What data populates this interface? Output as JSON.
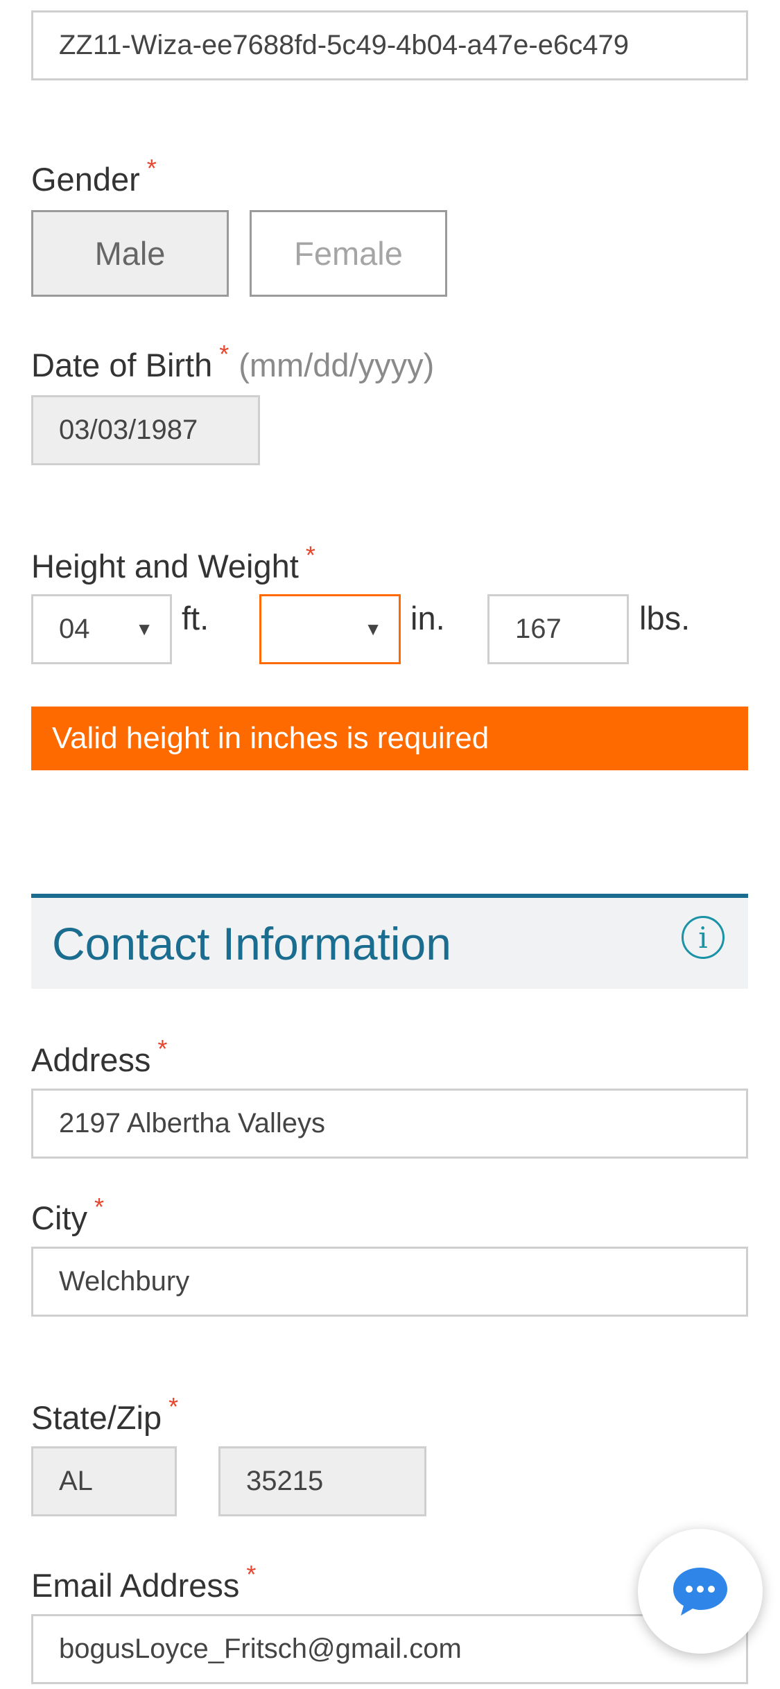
{
  "id_field": {
    "value": "ZZ11-Wiza-ee7688fd-5c49-4b04-a47e-e6c479"
  },
  "gender": {
    "label": "Gender",
    "required_mark": "*",
    "options": [
      "Male",
      "Female"
    ],
    "selected": "Male"
  },
  "dob": {
    "label": "Date of Birth",
    "required_mark": "*",
    "hint": "(mm/dd/yyyy)",
    "value": "03/03/1987"
  },
  "height_weight": {
    "label": "Height and Weight",
    "required_mark": "*",
    "feet_value": "04",
    "feet_unit": "ft.",
    "inches_value": "",
    "inches_unit": "in.",
    "weight_value": "167",
    "weight_unit": "lbs.",
    "caret": "▼",
    "error": "Valid height in inches is required"
  },
  "contact_section": {
    "title": "Contact Information",
    "info_glyph": "i"
  },
  "address": {
    "label": "Address",
    "required_mark": "*",
    "value": "2197 Albertha Valleys"
  },
  "city": {
    "label": "City",
    "required_mark": "*",
    "value": "Welchbury"
  },
  "state_zip": {
    "label": "State/Zip",
    "required_mark": "*",
    "state": "AL",
    "zip": "35215"
  },
  "email": {
    "label": "Email Address",
    "required_mark": "*",
    "value": "bogusLoyce_Fritsch@gmail.com"
  },
  "icons": {
    "info": "info-icon",
    "chat": "chat-bubble-icon",
    "caret": "caret-down-icon"
  },
  "colors": {
    "accent": "#1a6d8f",
    "error": "#ff6a00",
    "required": "#e8452c",
    "readonly_bg": "#eeeeee"
  }
}
